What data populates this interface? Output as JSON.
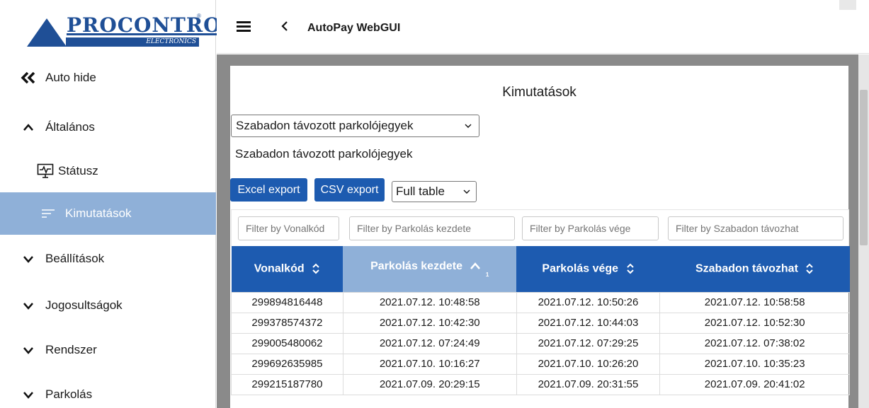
{
  "brand": {
    "name": "PROCONTROL",
    "sub": "ELECTRONICS",
    "reg": "®",
    "color": "#1f4f96"
  },
  "topbar": {
    "title": "AutoPay WebGUI",
    "back_icon": "‹"
  },
  "sidebar": {
    "items": [
      {
        "label": "Auto hide",
        "icon": "double-chevron-left-icon",
        "glyph": "«"
      },
      {
        "label": "Általános",
        "icon": "chevron-up-icon",
        "glyph": "^"
      },
      {
        "label": "Státusz",
        "icon": "monitor-pulse-icon"
      },
      {
        "label": "Kimutatások",
        "icon": "list-lines-icon",
        "active": true
      },
      {
        "label": "Beállítások",
        "icon": "chevron-down-icon",
        "glyph": "v"
      },
      {
        "label": "Jogosultságok",
        "icon": "chevron-down-icon",
        "glyph": "v"
      },
      {
        "label": "Rendszer",
        "icon": "chevron-down-icon",
        "glyph": "v"
      },
      {
        "label": "Parkolás",
        "icon": "chevron-down-icon",
        "glyph": "v"
      }
    ]
  },
  "page": {
    "title": "Kimutatások",
    "report_select": "Szabadon távozott parkolójegyek",
    "report_label": "Szabadon távozott parkolójegyek",
    "excel_button": "Excel export",
    "csv_button": "CSV export",
    "scope_select": "Full table"
  },
  "filters": [
    "Filter by Vonalkód",
    "Filter by Parkolás kezdete",
    "Filter by Parkolás vége",
    "Filter by Szabadon távozhat"
  ],
  "table": {
    "columns": [
      "Vonalkód",
      "Parkolás kezdete",
      "Parkolás vége",
      "Szabadon távozhat"
    ],
    "sort_index": "1",
    "rows": [
      [
        "299894816448",
        "2021.07.12. 10:48:58",
        "2021.07.12. 10:50:26",
        "2021.07.12. 10:58:58"
      ],
      [
        "299378574372",
        "2021.07.12. 10:42:30",
        "2021.07.12. 10:44:03",
        "2021.07.12. 10:52:30"
      ],
      [
        "299005480062",
        "2021.07.12. 07:24:49",
        "2021.07.12. 07:29:25",
        "2021.07.12. 07:38:02"
      ],
      [
        "299692635985",
        "2021.07.10. 10:16:27",
        "2021.07.10. 10:26:20",
        "2021.07.10. 10:35:23"
      ],
      [
        "299215187780",
        "2021.07.09. 20:29:15",
        "2021.07.09. 20:31:55",
        "2021.07.09. 20:41:02"
      ]
    ]
  },
  "colors": {
    "accent": "#1d5bb0",
    "active": "#8fb0d8"
  }
}
